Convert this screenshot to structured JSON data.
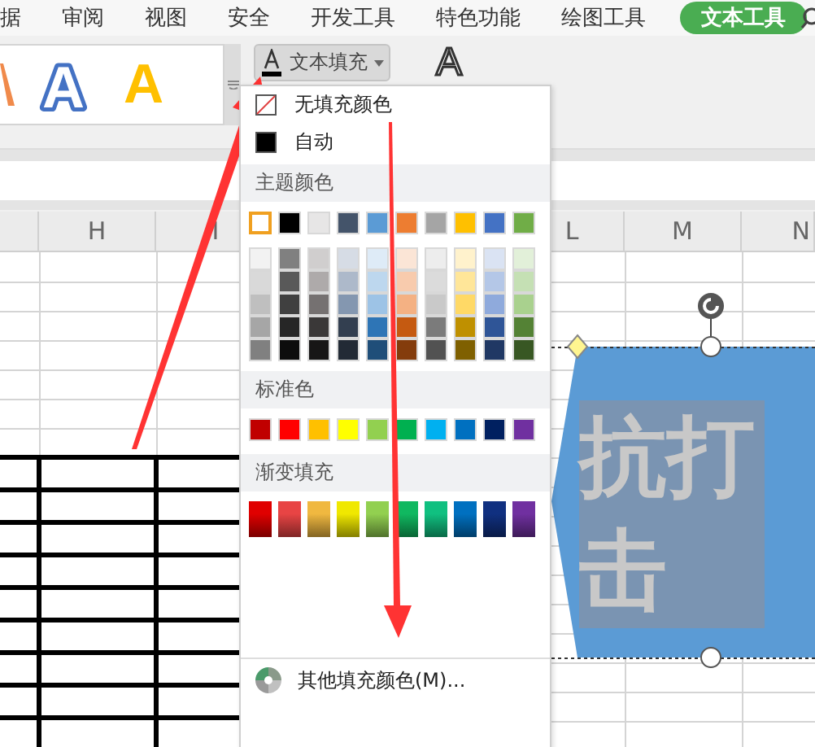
{
  "ribbon_tabs": [
    {
      "label": "据",
      "selected": false
    },
    {
      "label": "审阅",
      "selected": false
    },
    {
      "label": "视图",
      "selected": false
    },
    {
      "label": "安全",
      "selected": false
    },
    {
      "label": "开发工具",
      "selected": false
    },
    {
      "label": "特色功能",
      "selected": false
    },
    {
      "label": "绘图工具",
      "selected": false
    },
    {
      "label": "文本工具",
      "selected": true
    }
  ],
  "style_gallery": [
    {
      "kind": "partial",
      "color": "#f08a4b"
    },
    {
      "kind": "outline",
      "label": "A"
    },
    {
      "kind": "solid",
      "label": "A",
      "color": "#ffc000"
    }
  ],
  "text_fill_button": {
    "label": "文本填充"
  },
  "text_outline_button": {
    "label": "A"
  },
  "columns": [
    "H",
    "I",
    "L",
    "M",
    "N"
  ],
  "menu": {
    "items": [
      {
        "kind": "no_fill",
        "label": "无填充颜色"
      },
      {
        "kind": "auto",
        "label": "自动"
      }
    ],
    "sections": [
      {
        "kind": "theme",
        "title": "主题颜色",
        "swatches": [
          {
            "color": "#ffffff",
            "selected": true
          },
          {
            "color": "#000000",
            "selected": false
          },
          {
            "color": "#e7e6e6",
            "selected": false
          },
          {
            "color": "#44546a",
            "selected": false
          },
          {
            "color": "#5b9bd5",
            "selected": false
          },
          {
            "color": "#ed7d31",
            "selected": false
          },
          {
            "color": "#a5a5a5",
            "selected": false
          },
          {
            "color": "#ffc000",
            "selected": false
          },
          {
            "color": "#4472c4",
            "selected": false
          },
          {
            "color": "#70ad47",
            "selected": false
          }
        ],
        "shades": [
          [
            {
              "color": "#f2f2f2"
            },
            {
              "color": "#808080"
            },
            {
              "color": "#d0cece"
            },
            {
              "color": "#d6dce5"
            },
            {
              "color": "#deebf7"
            },
            {
              "color": "#fbe5d6"
            },
            {
              "color": "#ededed"
            },
            {
              "color": "#fff2cc"
            },
            {
              "color": "#dae3f3"
            },
            {
              "color": "#e2f0d9"
            }
          ],
          [
            {
              "color": "#d9d9d9"
            },
            {
              "color": "#595959"
            },
            {
              "color": "#aeaaaa"
            },
            {
              "color": "#adb9ca"
            },
            {
              "color": "#bdd7ee"
            },
            {
              "color": "#f8cbad"
            },
            {
              "color": "#dbdbdb"
            },
            {
              "color": "#ffe699"
            },
            {
              "color": "#b4c7e7"
            },
            {
              "color": "#c5e0b4"
            }
          ],
          [
            {
              "color": "#bfbfbf"
            },
            {
              "color": "#404040"
            },
            {
              "color": "#757171"
            },
            {
              "color": "#8497b0"
            },
            {
              "color": "#9dc3e6"
            },
            {
              "color": "#f4b183"
            },
            {
              "color": "#c9c9c9"
            },
            {
              "color": "#ffd966"
            },
            {
              "color": "#8faadc"
            },
            {
              "color": "#a9d18e"
            }
          ],
          [
            {
              "color": "#a6a6a6"
            },
            {
              "color": "#262626"
            },
            {
              "color": "#3a3838"
            },
            {
              "color": "#333f50"
            },
            {
              "color": "#2e75b6"
            },
            {
              "color": "#c55a11"
            },
            {
              "color": "#7b7b7b"
            },
            {
              "color": "#bf9000"
            },
            {
              "color": "#2f5597"
            },
            {
              "color": "#548235"
            }
          ],
          [
            {
              "color": "#808080"
            },
            {
              "color": "#0d0d0d"
            },
            {
              "color": "#171616"
            },
            {
              "color": "#222a35"
            },
            {
              "color": "#1f4e79"
            },
            {
              "color": "#843c0c"
            },
            {
              "color": "#525252"
            },
            {
              "color": "#7f6000"
            },
            {
              "color": "#203864"
            },
            {
              "color": "#385723"
            }
          ]
        ]
      },
      {
        "kind": "standard",
        "title": "标准色",
        "swatches": [
          {
            "color": "#c00000"
          },
          {
            "color": "#ff0000"
          },
          {
            "color": "#ffc000"
          },
          {
            "color": "#ffff00"
          },
          {
            "color": "#92d050"
          },
          {
            "color": "#00b050"
          },
          {
            "color": "#00b0f0"
          },
          {
            "color": "#0070c0"
          },
          {
            "color": "#002060"
          },
          {
            "color": "#7030a0"
          }
        ]
      },
      {
        "kind": "gradient",
        "title": "渐变填充",
        "swatches": [
          {
            "color": "#e00000"
          },
          {
            "color": "#e84444"
          },
          {
            "color": "#f0b840"
          },
          {
            "color": "#f0e800"
          },
          {
            "color": "#92d050"
          },
          {
            "color": "#10b860"
          },
          {
            "color": "#10c080"
          },
          {
            "color": "#0070c0"
          },
          {
            "color": "#103080"
          },
          {
            "color": "#7030a0"
          }
        ]
      }
    ],
    "more_colors": {
      "label": "其他填充颜色(M)..."
    }
  },
  "shape": {
    "text": "抗打击",
    "selected": true
  }
}
